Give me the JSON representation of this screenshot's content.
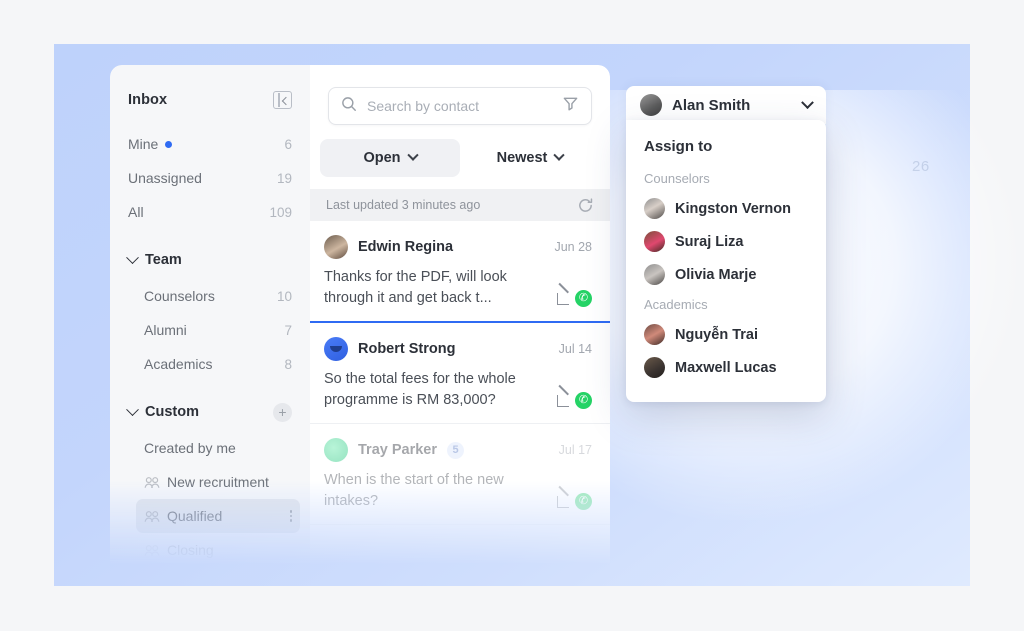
{
  "sidebar": {
    "title": "Inbox",
    "collapse_icon": "panel-collapse-icon",
    "primary": [
      {
        "label": "Mine",
        "count": "6",
        "dot": true
      },
      {
        "label": "Unassigned",
        "count": "19",
        "dot": false
      },
      {
        "label": "All",
        "count": "109",
        "dot": false
      }
    ],
    "team": {
      "label": "Team",
      "items": [
        {
          "label": "Counselors",
          "count": "10"
        },
        {
          "label": "Alumni",
          "count": "7"
        },
        {
          "label": "Academics",
          "count": "8"
        }
      ]
    },
    "custom": {
      "label": "Custom",
      "add_label": "+",
      "items": [
        {
          "label": "Created by me",
          "icon": false,
          "selected": false
        },
        {
          "label": "New recruitment",
          "icon": true,
          "selected": false
        },
        {
          "label": "Qualified",
          "icon": true,
          "selected": true
        },
        {
          "label": "Closing",
          "icon": true,
          "selected": false
        }
      ]
    }
  },
  "list": {
    "search": {
      "placeholder": "Search by contact",
      "value": "",
      "search_icon": "search-icon",
      "filter_icon": "filter-funnel-icon"
    },
    "filters": [
      {
        "label": "Open",
        "active": true
      },
      {
        "label": "Newest",
        "active": false
      }
    ],
    "updated": {
      "text": "Last updated 3 minutes ago",
      "refresh_icon": "refresh-icon"
    },
    "conversations": [
      {
        "name": "Edwin Regina",
        "date": "Jun 28",
        "preview": "Thanks for the PDF, will look through it and get back t...",
        "badge": "",
        "channel_icon": "whatsapp-icon",
        "direction_icon": "incoming-arrow-icon",
        "selected": true,
        "faded": false
      },
      {
        "name": "Robert Strong",
        "date": "Jul 14",
        "preview": "So the total fees for the whole programme is RM 83,000?",
        "badge": "",
        "channel_icon": "whatsapp-icon",
        "direction_icon": "incoming-arrow-icon",
        "selected": false,
        "faded": false
      },
      {
        "name": "Tray Parker",
        "date": "Jul 17",
        "preview": "When is the start of the new intakes?",
        "badge": "5",
        "channel_icon": "whatsapp-icon",
        "direction_icon": "incoming-arrow-icon",
        "selected": false,
        "faded": true
      }
    ]
  },
  "assign": {
    "trigger": {
      "name": "Alan Smith",
      "chevron": "chevron-down-icon"
    },
    "title": "Assign to",
    "groups": [
      {
        "label": "Counselors",
        "people": [
          "Kingston Vernon",
          "Suraj Liza",
          "Olivia Marje"
        ]
      },
      {
        "label": "Academics",
        "people": [
          "Nguyễn Trai",
          "Maxwell Lucas"
        ]
      }
    ]
  },
  "background": {
    "ghost_number": "26",
    "panel_color": "#c3d5fc",
    "accent_color": "#2f6bf3",
    "whatsapp_color": "#25d366"
  }
}
